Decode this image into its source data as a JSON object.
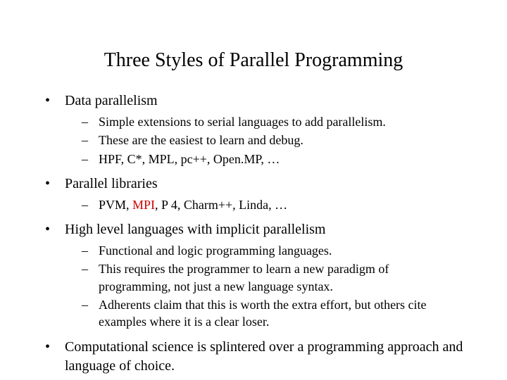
{
  "title": "Three Styles of Parallel Programming",
  "bullets": [
    {
      "text": "Data parallelism",
      "sub": [
        "Simple extensions to serial languages to add parallelism.",
        "These are the easiest to learn and debug.",
        "HPF, C*, MPL, pc++, Open.MP, …"
      ]
    },
    {
      "text": "Parallel libraries",
      "sub_html": [
        "PVM, <span class=\"mpi\">MPI</span>, P 4, Charm++, Linda, …"
      ]
    },
    {
      "text": "High level languages with implicit parallelism",
      "sub": [
        "Functional and logic programming languages.",
        "This requires the programmer to learn a new paradigm of programming, not just a new language syntax.",
        "Adherents claim that this is worth the extra effort, but others cite examples where it is a clear loser."
      ]
    },
    {
      "text": "Computational science is splintered over a programming approach and language of choice."
    }
  ]
}
